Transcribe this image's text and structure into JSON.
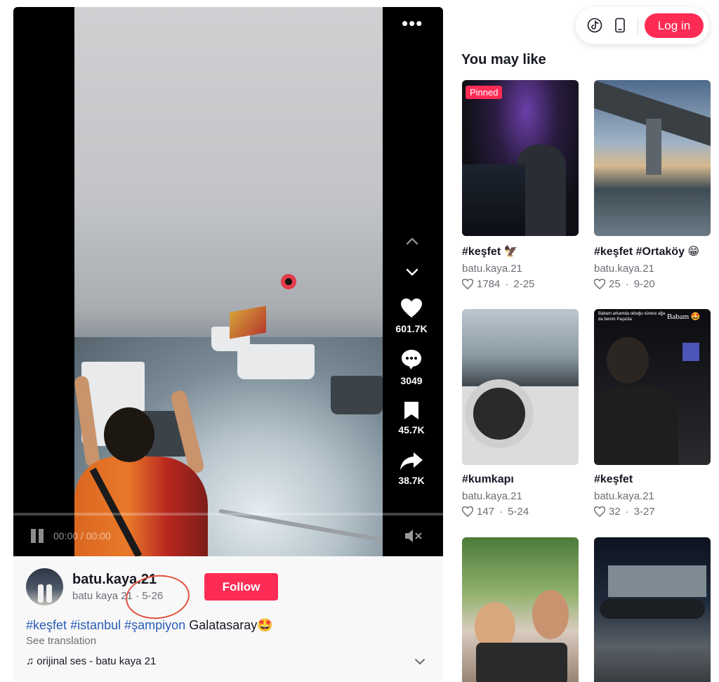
{
  "video": {
    "counts": {
      "likes": "601.7K",
      "comments": "3049",
      "saves": "45.7K",
      "shares": "38.7K"
    },
    "time": "00:00 / 00:00"
  },
  "post": {
    "username": "batu.kaya.21",
    "display_name": "batu kaya 21",
    "date": "5-26",
    "separator": "·",
    "follow_label": "Follow",
    "hashtags": [
      "#keşfet",
      "#istanbul",
      "#şampiyon"
    ],
    "caption_text": "Galatasaray🤩",
    "see_translation": "See translation",
    "music": "orijinal ses - batu kaya 21"
  },
  "toolbar": {
    "login_label": "Log in"
  },
  "you_may_like": {
    "title": "You may like",
    "items": [
      {
        "title": "#keşfet 🦅",
        "author": "batu.kaya.21",
        "likes": "1784",
        "date": "2-25",
        "pinned": "Pinned"
      },
      {
        "title": "#keşfet #Ortaköy 😁",
        "author": "batu.kaya.21",
        "likes": "25",
        "date": "9-20"
      },
      {
        "title": "#kumkapı",
        "author": "batu.kaya.21",
        "likes": "147",
        "date": "5-24"
      },
      {
        "title": "#keşfet",
        "author": "batu.kaya.21",
        "likes": "32",
        "date": "3-27",
        "overlay_text": "Babam 🤩",
        "overlay_caption": "Babam arkamda olduğu sürece ağa da benim Paşa'da"
      },
      {
        "title": "",
        "author": "",
        "likes": "",
        "date": ""
      },
      {
        "title": "",
        "author": "",
        "likes": "",
        "date": ""
      }
    ]
  },
  "colors": {
    "accent": "#fe2c55",
    "hashtag": "#2b5db9",
    "annotation_circle": "#e0523e"
  }
}
